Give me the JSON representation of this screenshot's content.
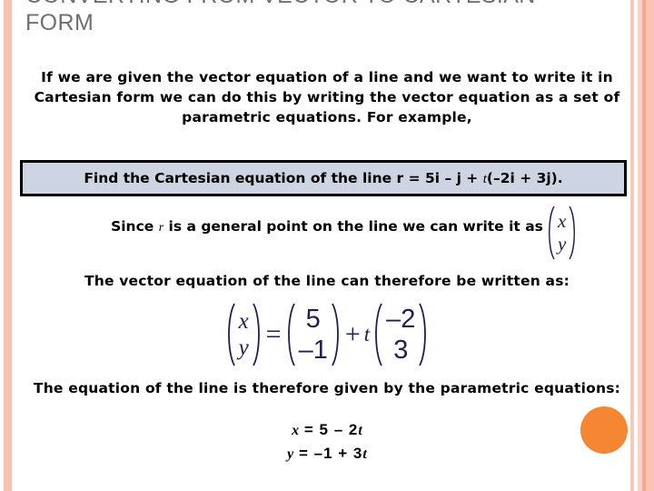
{
  "slide": {
    "title": "CONVERTING FROM VECTOR TO CARTESIAN FORM",
    "intro_text": "If we are given the vector equation of a line and we want to write it in Cartesian form we can do this by writing the vector equation as a set of parametric equations. For example,",
    "question": {
      "prefix": "Find the Cartesian equation of the line r = 5i – j + ",
      "param": "t",
      "suffix": "(–2i + 3j)."
    },
    "since_line": {
      "prefix": "Since ",
      "param": "r",
      "suffix": " is a general point on the line we can write it as"
    },
    "small_vector": {
      "top": "x",
      "bottom": "y"
    },
    "vector_equation_text": "The vector equation of the line can therefore be written as:",
    "matrix_equation": {
      "lhs": {
        "top": "x",
        "bottom": "y"
      },
      "equals": "=",
      "point": {
        "top": "5",
        "bottom": "–1"
      },
      "plus": "+",
      "scalar": "t",
      "direction": {
        "top": "–2",
        "bottom": "3"
      }
    },
    "parametric_intro_text": "The equation of the line is therefore given by the parametric equations:",
    "parametric_equations": {
      "x_var": "x",
      "x_body": " = 5 – 2",
      "x_param": "t",
      "y_var": "y",
      "y_body": " = –1 + 3",
      "y_param": "t"
    },
    "colors": {
      "title": "#6E6E73",
      "box_fill": "#CED5E2",
      "box_border": "#000000",
      "math_navy": "#1F1F4F",
      "accent_orange": "#F58634",
      "stripe_salmon": "#F6C3B2"
    }
  }
}
